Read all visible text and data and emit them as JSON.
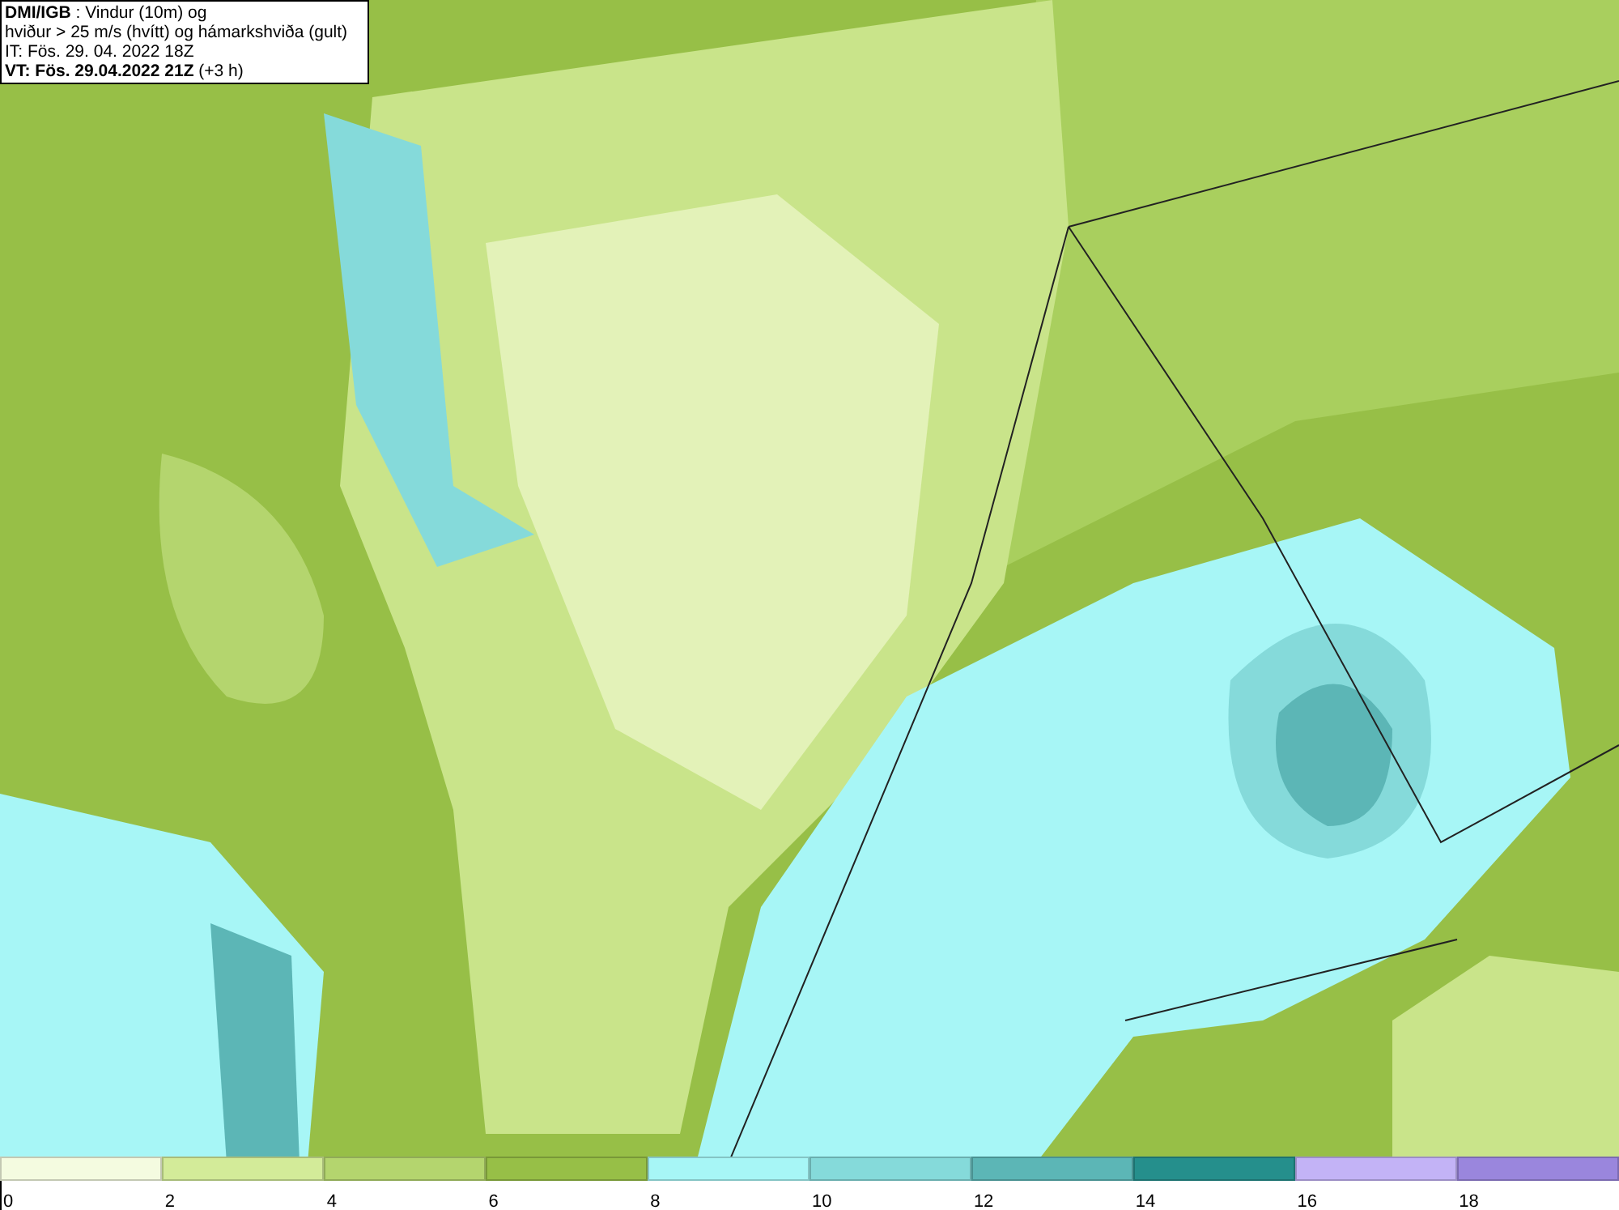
{
  "title_box": {
    "lines": [
      "**DMI/IGB** : Vindur (10m) og",
      "hviður > 25 m/s (hvítt) og hámarkshviða (gult)",
      "IT: Fös. 29. 04. 2022 18Z",
      "**VT: Fös. 29.04.2022 21Z** (+3 h)"
    ]
  },
  "legend": {
    "bins": [
      {
        "label": "0",
        "color": "#f4fbe0"
      },
      {
        "label": "2",
        "color": "#d3eb99"
      },
      {
        "label": "4",
        "color": "#b4d56e"
      },
      {
        "label": "6",
        "color": "#97bf47"
      },
      {
        "label": "8",
        "color": "#a7f6f6"
      },
      {
        "label": "10",
        "color": "#85dada"
      },
      {
        "label": "12",
        "color": "#5cb6b6"
      },
      {
        "label": "14",
        "color": "#258f8c"
      },
      {
        "label": "16",
        "color": "#c3b3f6"
      },
      {
        "label": "18",
        "color": "#9a86dd"
      }
    ]
  }
}
